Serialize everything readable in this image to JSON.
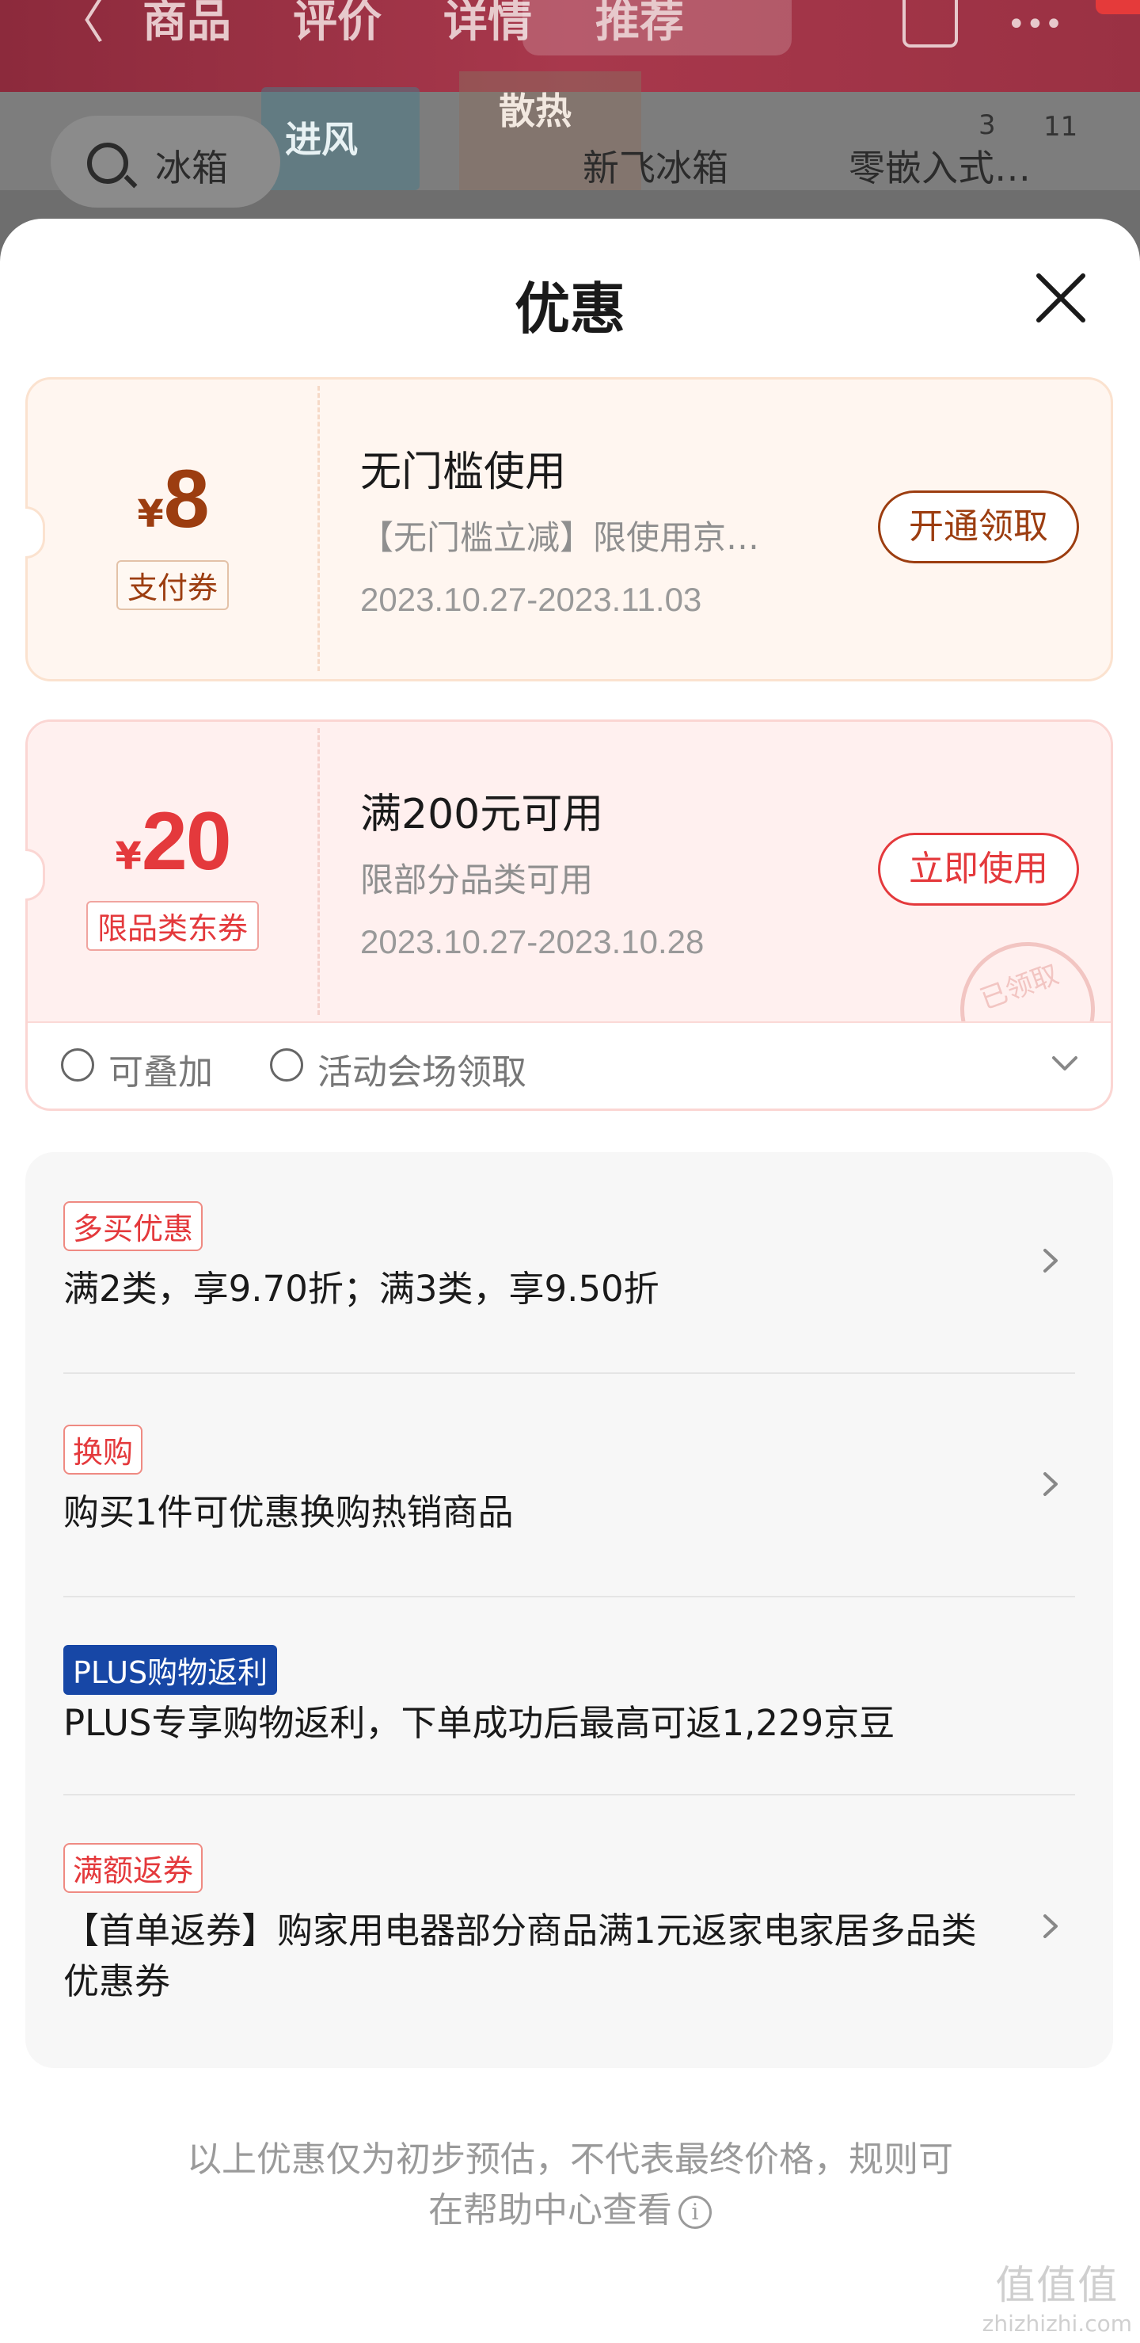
{
  "background": {
    "nav_back": "〈",
    "nav_tabs": [
      "商品",
      "评价",
      "详情",
      "推荐"
    ],
    "search_text": "冰箱",
    "search_suggestions": [
      "新飞冰箱",
      "零嵌入式…"
    ],
    "badge_numbers": [
      "3",
      "11"
    ],
    "overlay_texts": [
      "进风",
      "散热"
    ]
  },
  "sheet": {
    "title": "优惠",
    "close_icon": "close-icon"
  },
  "coupons": [
    {
      "currency": "¥",
      "amount": "8",
      "tag": "支付券",
      "title": "无门槛使用",
      "desc": "【无门槛立减】限使用京…",
      "date": "2023.10.27-2023.11.03",
      "button": "开通领取",
      "accent": "#9c3d10"
    },
    {
      "currency": "¥",
      "amount": "20",
      "tag": "限品类东券",
      "title": "满200元可用",
      "desc": "限部分品类可用",
      "date": "2023.10.27-2023.10.28",
      "button": "立即使用",
      "stamp": "已领取",
      "accent": "#e4393c",
      "meta": [
        "可叠加",
        "活动会场领取"
      ]
    }
  ],
  "promotions": [
    {
      "tag": "多买优惠",
      "text": "满2类，享9.70折；满3类，享9.50折",
      "has_arrow": true
    },
    {
      "tag": "换购",
      "text": "购买1件可优惠换购热销商品",
      "has_arrow": true
    },
    {
      "tag": "PLUS购物返利",
      "text": "PLUS专享购物返利，下单成功后最高可返1,229京豆",
      "has_arrow": false
    },
    {
      "tag": "满额返券",
      "text": "【首单返券】购家用电器部分商品满1元返家电家居多品类优惠券",
      "has_arrow": true
    }
  ],
  "footer": {
    "note_line1": "以上优惠仅为初步预估，不代表最终价格，规则可",
    "note_line2": "在帮助中心查看",
    "info_icon": "i"
  },
  "watermark": {
    "big": "值值值",
    "small": "zhizhizhi.com"
  }
}
